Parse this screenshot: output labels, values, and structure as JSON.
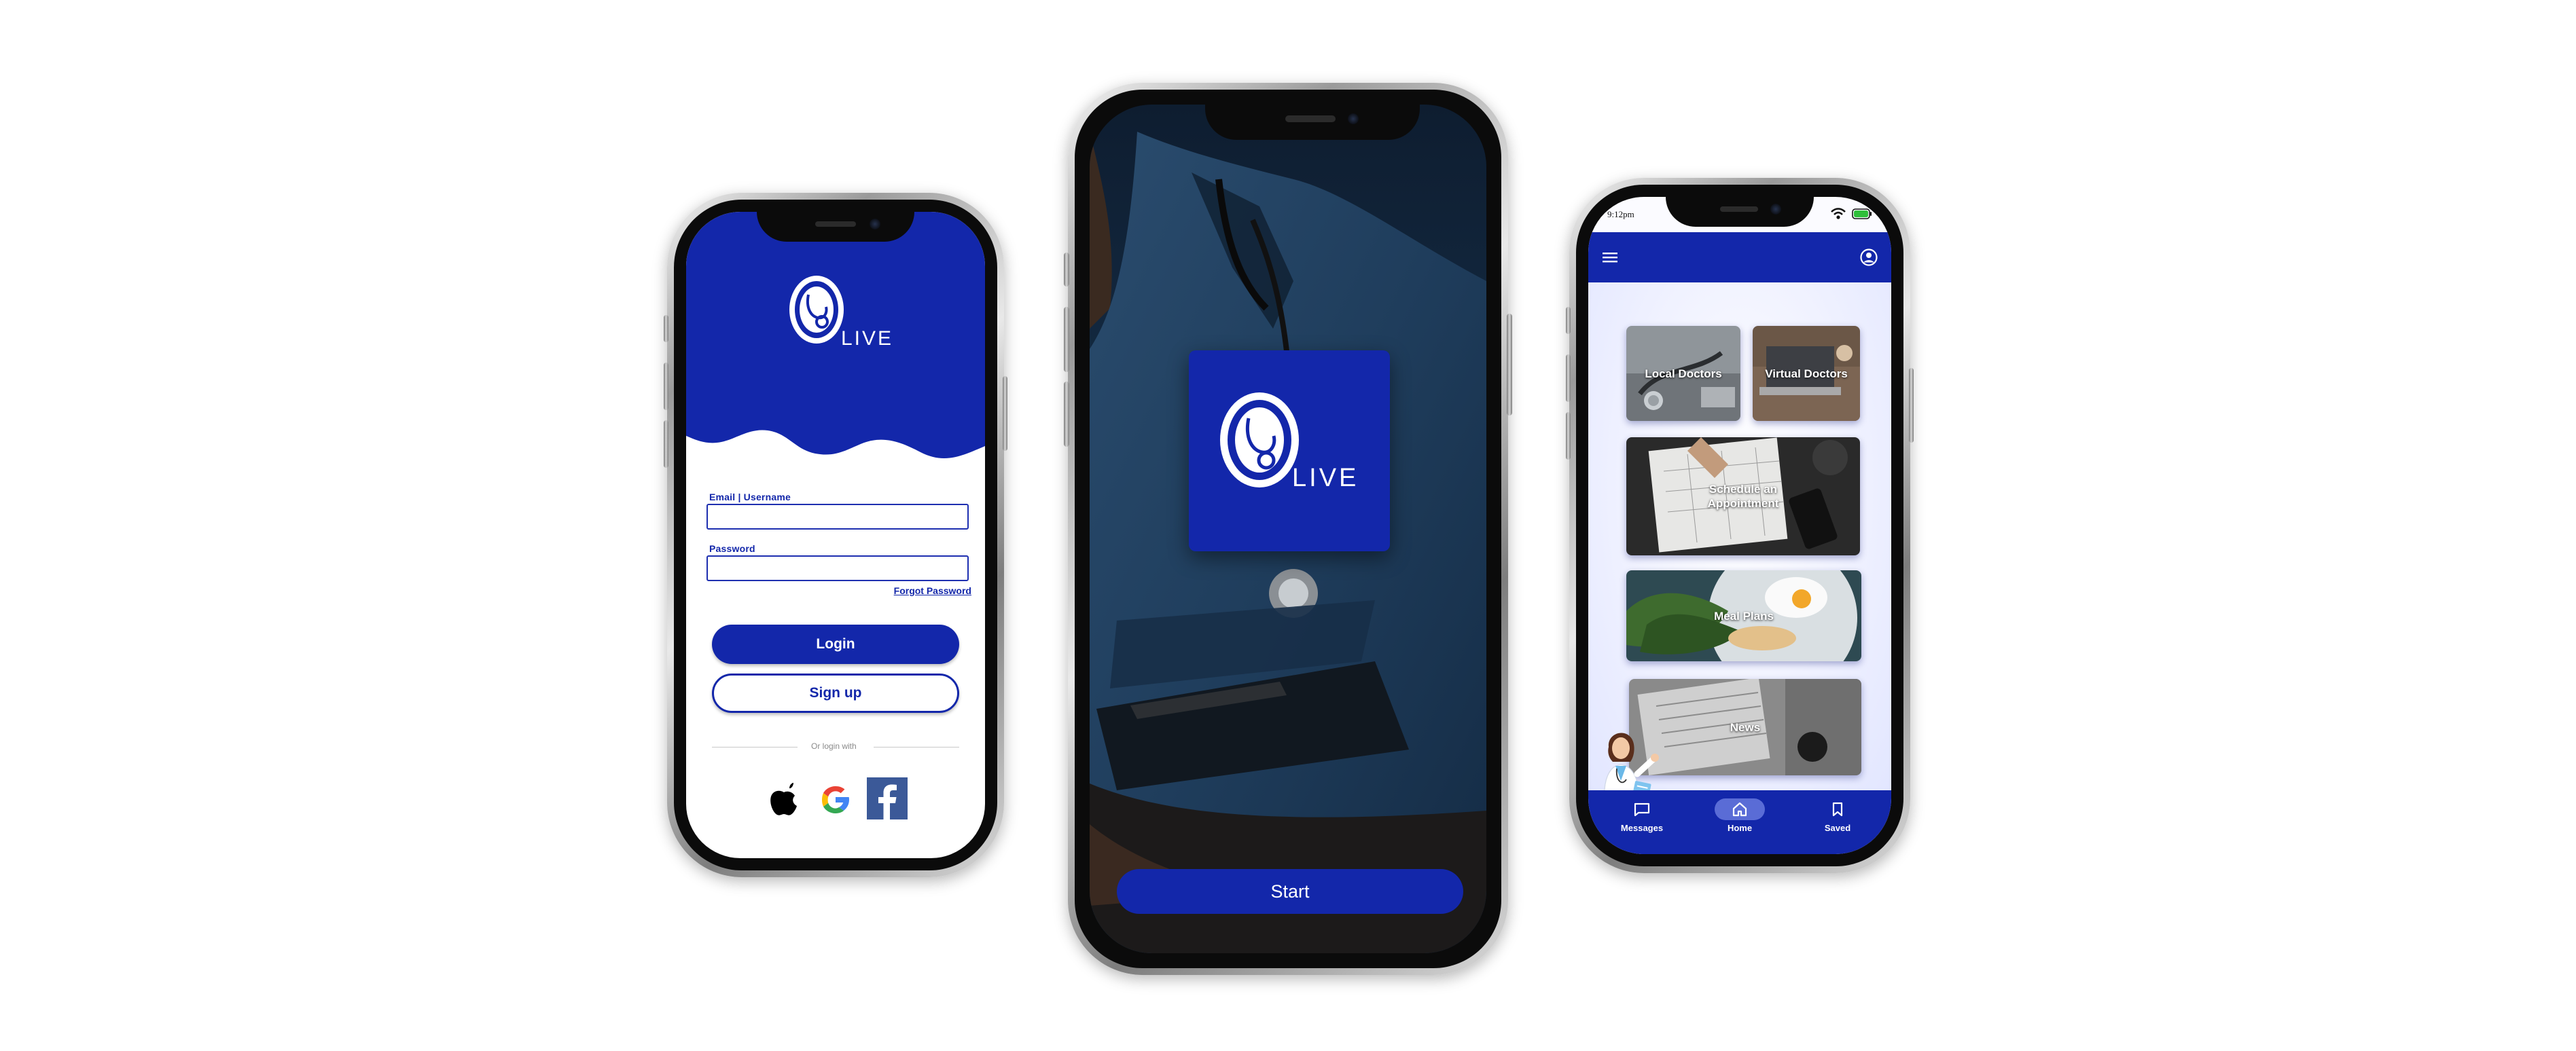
{
  "brand": {
    "name": "LIVE",
    "primary_color": "#1327aa",
    "text_on_primary": "#ffffff"
  },
  "login_screen": {
    "email_label": "Email | Username",
    "email_value": "",
    "password_label": "Password",
    "password_value": "",
    "forgot_password": "Forgot Password",
    "login_button": "Login",
    "signup_button": "Sign up",
    "divider_text": "Or login with",
    "social_logins": [
      "apple-icon",
      "google-icon",
      "facebook-icon"
    ]
  },
  "splash_screen": {
    "start_button": "Start"
  },
  "home_screen": {
    "status_time": "9:12pm",
    "cards": [
      {
        "label": "Local Doctors"
      },
      {
        "label": "Virtual Doctors"
      },
      {
        "label": "Schedule an Appointment"
      },
      {
        "label": "Meal Plans"
      },
      {
        "label": "News"
      }
    ],
    "bottom_nav": [
      {
        "label": "Messages",
        "icon": "chat-icon",
        "active": false
      },
      {
        "label": "Home",
        "icon": "home-icon",
        "active": true
      },
      {
        "label": "Saved",
        "icon": "bookmark-icon",
        "active": false
      }
    ]
  }
}
